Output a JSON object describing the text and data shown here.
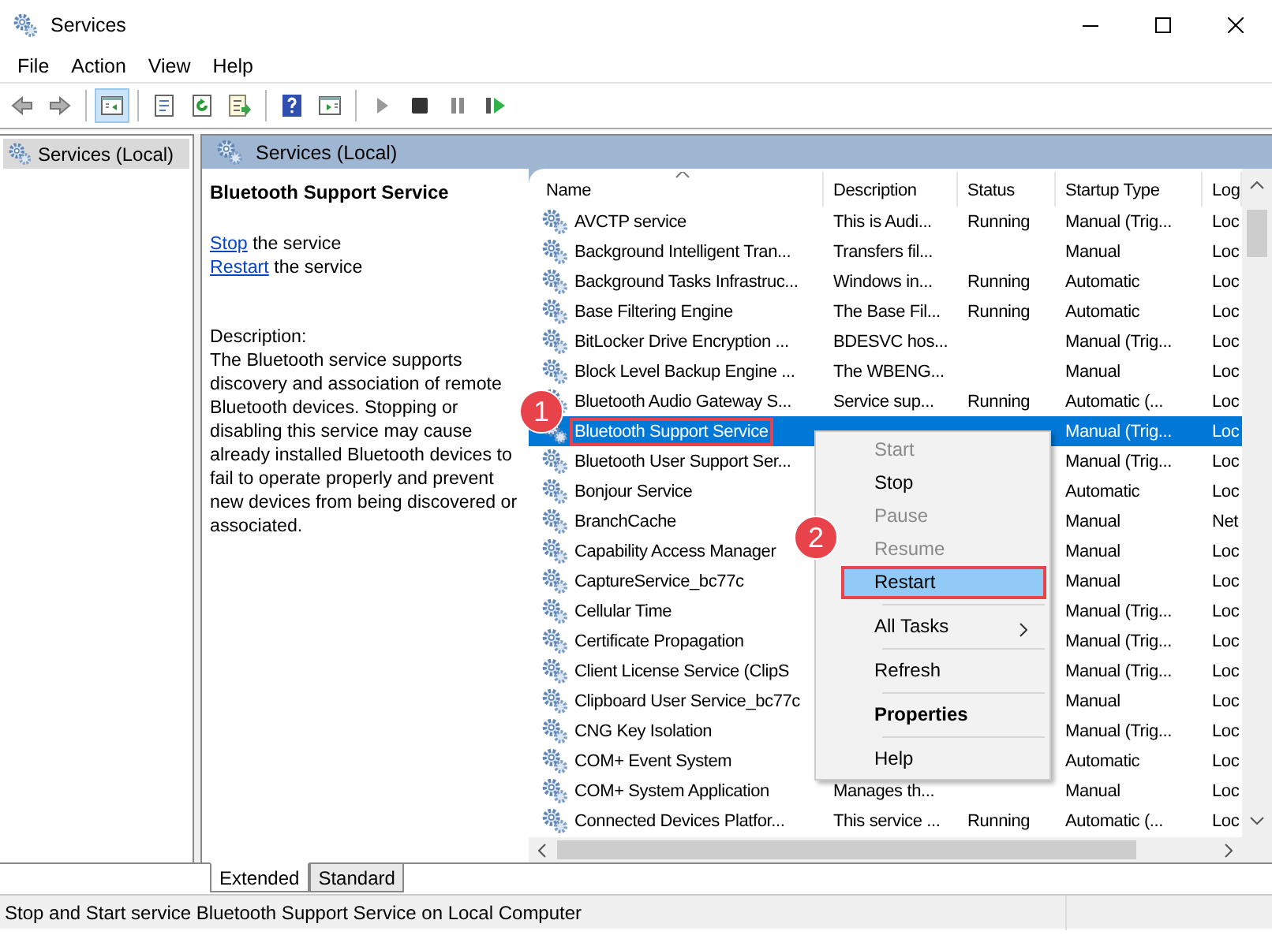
{
  "window": {
    "title": "Services"
  },
  "menu_bar": [
    {
      "label": "File"
    },
    {
      "label": "Action"
    },
    {
      "label": "View"
    },
    {
      "label": "Help"
    }
  ],
  "toolbar": [
    {
      "kind": "back",
      "pressed": false
    },
    {
      "kind": "forward",
      "pressed": false
    },
    {
      "kind": "separator"
    },
    {
      "kind": "console-tree",
      "pressed": true
    },
    {
      "kind": "separator"
    },
    {
      "kind": "properties",
      "pressed": false
    },
    {
      "kind": "refresh",
      "pressed": false
    },
    {
      "kind": "export",
      "pressed": false
    },
    {
      "kind": "separator"
    },
    {
      "kind": "help",
      "pressed": false
    },
    {
      "kind": "action-pane",
      "pressed": false
    },
    {
      "kind": "separator"
    },
    {
      "kind": "start",
      "pressed": false
    },
    {
      "kind": "stop",
      "pressed": false
    },
    {
      "kind": "pause",
      "pressed": false
    },
    {
      "kind": "resume",
      "pressed": false
    }
  ],
  "tree": {
    "items": [
      {
        "label": "Services (Local)",
        "selected": true
      }
    ]
  },
  "pane_header": {
    "title": "Services (Local)"
  },
  "detail": {
    "title": "Bluetooth Support Service",
    "actions": [
      {
        "link": "Stop",
        "text": "the service"
      },
      {
        "link": "Restart",
        "text": "the service"
      }
    ],
    "description_label": "Description:",
    "description": "The Bluetooth service supports discovery and association of remote Bluetooth devices.  Stopping or disabling this service may cause already installed Bluetooth devices to fail to operate properly and prevent new devices from being discovered or associated."
  },
  "table": {
    "columns": [
      {
        "label": "Name",
        "sorted": true
      },
      {
        "label": "Description",
        "sorted": false
      },
      {
        "label": "Status",
        "sorted": false
      },
      {
        "label": "Startup Type",
        "sorted": false
      },
      {
        "label": "Log",
        "sorted": false
      }
    ],
    "rows": [
      {
        "name": "AVCTP service",
        "description": "This is Audi...",
        "status": "Running",
        "startup_type": "Manual (Trig...",
        "log_on_as": "Loc",
        "selected": false,
        "highlighted": false
      },
      {
        "name": "Background Intelligent Tran...",
        "description": "Transfers fil...",
        "startup_type": "Manual",
        "log_on_as": "Loc",
        "selected": false,
        "highlighted": false
      },
      {
        "name": "Background Tasks Infrastruc...",
        "description": "Windows in...",
        "status": "Running",
        "startup_type": "Automatic",
        "log_on_as": "Loc",
        "selected": false,
        "highlighted": false
      },
      {
        "name": "Base Filtering Engine",
        "description": "The Base Fil...",
        "status": "Running",
        "startup_type": "Automatic",
        "log_on_as": "Loc",
        "selected": false,
        "highlighted": false
      },
      {
        "name": "BitLocker Drive Encryption ...",
        "description": "BDESVC hos...",
        "startup_type": "Manual (Trig...",
        "log_on_as": "Loc",
        "selected": false,
        "highlighted": false
      },
      {
        "name": "Block Level Backup Engine ...",
        "description": "The WBENG...",
        "startup_type": "Manual",
        "log_on_as": "Loc",
        "selected": false,
        "highlighted": false
      },
      {
        "name": "Bluetooth Audio Gateway S...",
        "description": "Service sup...",
        "status": "Running",
        "startup_type": "Automatic (...",
        "log_on_as": "Loc",
        "selected": false,
        "highlighted": false
      },
      {
        "name": "Bluetooth Support Service",
        "startup_type": "Manual (Trig...",
        "log_on_as": "Loc",
        "selected": true,
        "highlighted": true,
        "badge": "1"
      },
      {
        "name": "Bluetooth User Support Ser...",
        "startup_type": "Manual (Trig...",
        "log_on_as": "Loc",
        "selected": false,
        "highlighted": false
      },
      {
        "name": "Bonjour Service",
        "startup_type": "Automatic",
        "log_on_as": "Loc",
        "selected": false,
        "highlighted": false
      },
      {
        "name": "BranchCache",
        "startup_type": "Manual",
        "log_on_as": "Net",
        "selected": false,
        "highlighted": false
      },
      {
        "name": "Capability Access Manager",
        "startup_type": "Manual",
        "log_on_as": "Loc",
        "selected": false,
        "highlighted": false
      },
      {
        "name": "CaptureService_bc77c",
        "startup_type": "Manual",
        "log_on_as": "Loc",
        "selected": false,
        "highlighted": false
      },
      {
        "name": "Cellular Time",
        "startup_type": "Manual (Trig...",
        "log_on_as": "Loc",
        "selected": false,
        "highlighted": false
      },
      {
        "name": "Certificate Propagation",
        "startup_type": "Manual (Trig...",
        "log_on_as": "Loc",
        "selected": false,
        "highlighted": false
      },
      {
        "name": "Client License Service (ClipS",
        "startup_type": "Manual (Trig...",
        "log_on_as": "Loc",
        "selected": false,
        "highlighted": false
      },
      {
        "name": "Clipboard User Service_bc77c",
        "startup_type": "Manual",
        "log_on_as": "Loc",
        "selected": false,
        "highlighted": false
      },
      {
        "name": "CNG Key Isolation",
        "startup_type": "Manual (Trig...",
        "log_on_as": "Loc",
        "selected": false,
        "highlighted": false
      },
      {
        "name": "COM+ Event System",
        "startup_type": "Automatic",
        "log_on_as": "Loc",
        "selected": false,
        "highlighted": false
      },
      {
        "name": "COM+ System Application",
        "description": "Manages th...",
        "startup_type": "Manual",
        "log_on_as": "Loc",
        "selected": false,
        "highlighted": false
      },
      {
        "name": "Connected Devices Platfor...",
        "description": "This service ...",
        "status": "Running",
        "startup_type": "Automatic (...",
        "log_on_as": "Loc",
        "selected": false,
        "highlighted": false
      }
    ]
  },
  "context_menu": {
    "items": [
      {
        "kind": "item",
        "label": "Start",
        "disabled": true,
        "highlighted": false
      },
      {
        "kind": "item",
        "label": "Stop",
        "disabled": false,
        "highlighted": false
      },
      {
        "kind": "item",
        "label": "Pause",
        "disabled": true,
        "highlighted": false
      },
      {
        "kind": "item",
        "label": "Resume",
        "disabled": true,
        "highlighted": false
      },
      {
        "kind": "item",
        "label": "Restart",
        "disabled": false,
        "highlighted": true,
        "badge": "2"
      },
      {
        "kind": "separator"
      },
      {
        "kind": "submenu",
        "label": "All Tasks",
        "disabled": false,
        "highlighted": false
      },
      {
        "kind": "separator"
      },
      {
        "kind": "item",
        "label": "Refresh",
        "disabled": false,
        "highlighted": false
      },
      {
        "kind": "separator"
      },
      {
        "kind": "default",
        "label": "Properties",
        "disabled": false,
        "highlighted": false
      },
      {
        "kind": "separator"
      },
      {
        "kind": "item",
        "label": "Help",
        "disabled": false,
        "highlighted": false
      }
    ]
  },
  "view_tabs": [
    {
      "label": "Extended",
      "selected": true
    },
    {
      "label": "Standard",
      "selected": false
    }
  ],
  "status_bar": {
    "text": "Stop and Start service Bluetooth Support Service on Local Computer"
  }
}
